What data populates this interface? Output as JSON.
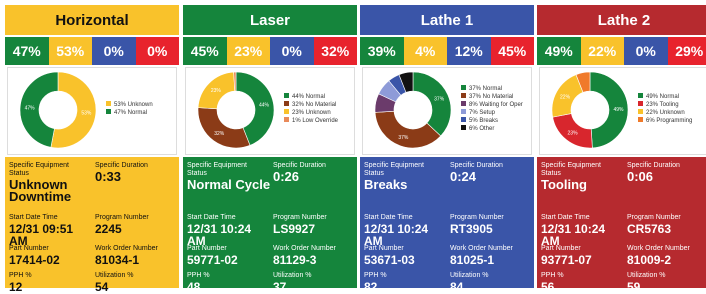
{
  "panels": [
    {
      "title": "Horizontal",
      "header_color": "#f9c22b",
      "header_text_color": "#111111",
      "info_color": "#f9c22b",
      "info_text_color": "#111111",
      "percent_cells": [
        {
          "text": "47%",
          "color": "#15853c"
        },
        {
          "text": "53%",
          "color": "#f9c22b"
        },
        {
          "text": "0%",
          "color": "#3a55a8"
        },
        {
          "text": "0%",
          "color": "#e8232d"
        }
      ],
      "donut": [
        {
          "label": "53% Unknown",
          "value": 53,
          "color": "#f9c22b",
          "slice_label": "53%"
        },
        {
          "label": "47% Normal",
          "value": 47,
          "color": "#15853c",
          "slice_label": "47%"
        }
      ],
      "status_label": "Specific Equipment Status",
      "status_value": "Unknown Downtime",
      "duration_label": "Specific Duration",
      "duration_value": "0:33",
      "start_label": "Start Date Time",
      "start_value": "12/31 09:51 AM",
      "program_label": "Program Number",
      "program_value": "2245",
      "part_label": "Part Number",
      "part_value": "17414-02",
      "workorder_label": "Work Order Number",
      "workorder_value": "81034-1",
      "pph_label": "PPH %",
      "pph_value": "12",
      "util_label": "Utilization %",
      "util_value": "54"
    },
    {
      "title": "Laser",
      "header_color": "#15853c",
      "header_text_color": "#ffffff",
      "info_color": "#15853c",
      "info_text_color": "#ffffff",
      "percent_cells": [
        {
          "text": "45%",
          "color": "#15853c"
        },
        {
          "text": "23%",
          "color": "#f9c22b"
        },
        {
          "text": "0%",
          "color": "#3a55a8"
        },
        {
          "text": "32%",
          "color": "#e8232d"
        }
      ],
      "donut": [
        {
          "label": "44% Normal",
          "value": 44,
          "color": "#15853c",
          "slice_label": "44%"
        },
        {
          "label": "32% No Material",
          "value": 32,
          "color": "#8b3b17",
          "slice_label": "32%"
        },
        {
          "label": "23% Unknown",
          "value": 23,
          "color": "#f9c22b",
          "slice_label": "23%"
        },
        {
          "label": "1% Low Override",
          "value": 1,
          "color": "#e98a5a",
          "slice_label": ""
        }
      ],
      "status_label": "Specific Equipment Status",
      "status_value": "Normal Cycle",
      "duration_label": "Specific Duration",
      "duration_value": "0:26",
      "start_label": "Start Date Time",
      "start_value": "12/31 10:24 AM",
      "program_label": "Program Number",
      "program_value": "LS9927",
      "part_label": "Part Number",
      "part_value": "59771-02",
      "workorder_label": "Work Order Number",
      "workorder_value": "81129-3",
      "pph_label": "PPH %",
      "pph_value": "48",
      "util_label": "Utilization %",
      "util_value": "37"
    },
    {
      "title": "Lathe 1",
      "header_color": "#3a55a8",
      "header_text_color": "#ffffff",
      "info_color": "#3a55a8",
      "info_text_color": "#ffffff",
      "percent_cells": [
        {
          "text": "39%",
          "color": "#15853c"
        },
        {
          "text": "4%",
          "color": "#f9c22b"
        },
        {
          "text": "12%",
          "color": "#3a55a8"
        },
        {
          "text": "45%",
          "color": "#e8232d"
        }
      ],
      "donut": [
        {
          "label": "37% Normal",
          "value": 37,
          "color": "#15853c",
          "slice_label": "37%"
        },
        {
          "label": "37% No Material",
          "value": 37,
          "color": "#8b3b17",
          "slice_label": "37%"
        },
        {
          "label": "8% Waiting for Oper",
          "value": 8,
          "color": "#6b3b6b",
          "slice_label": ""
        },
        {
          "label": "7% Setup",
          "value": 7,
          "color": "#8e9bd8",
          "slice_label": ""
        },
        {
          "label": "5% Breaks",
          "value": 5,
          "color": "#3a55a8",
          "slice_label": ""
        },
        {
          "label": "6% Other",
          "value": 6,
          "color": "#111111",
          "slice_label": ""
        }
      ],
      "status_label": "Specific Equipment Status",
      "status_value": "Breaks",
      "duration_label": "Specific Duration",
      "duration_value": "0:24",
      "start_label": "Start Date Time",
      "start_value": "12/31 10:24 AM",
      "program_label": "Program Number",
      "program_value": "RT3905",
      "part_label": "Part Number",
      "part_value": "53671-03",
      "workorder_label": "Work Order Number",
      "workorder_value": "81025-1",
      "pph_label": "PPH %",
      "pph_value": "82",
      "util_label": "Utilization %",
      "util_value": "84"
    },
    {
      "title": "Lathe 2",
      "header_color": "#b62a2f",
      "header_text_color": "#ffffff",
      "info_color": "#b62a2f",
      "info_text_color": "#ffffff",
      "percent_cells": [
        {
          "text": "49%",
          "color": "#15853c"
        },
        {
          "text": "22%",
          "color": "#f9c22b"
        },
        {
          "text": "0%",
          "color": "#3a55a8"
        },
        {
          "text": "29%",
          "color": "#e8232d"
        }
      ],
      "donut": [
        {
          "label": "49% Normal",
          "value": 49,
          "color": "#15853c",
          "slice_label": "49%"
        },
        {
          "label": "23% Tooling",
          "value": 23,
          "color": "#d8262d",
          "slice_label": "23%"
        },
        {
          "label": "22% Unknown",
          "value": 22,
          "color": "#f9c22b",
          "slice_label": "22%"
        },
        {
          "label": "6% Programming",
          "value": 6,
          "color": "#f07a2a",
          "slice_label": ""
        }
      ],
      "status_label": "Specific Equipment Status",
      "status_value": "Tooling",
      "duration_label": "Specific Duration",
      "duration_value": "0:06",
      "start_label": "Start Date Time",
      "start_value": "12/31 10:24 AM",
      "program_label": "Program Number",
      "program_value": "CR5763",
      "part_label": "Part Number",
      "part_value": "93771-07",
      "workorder_label": "Work Order Number",
      "workorder_value": "81009-2",
      "pph_label": "PPH %",
      "pph_value": "56",
      "util_label": "Utilization %",
      "util_value": "59"
    }
  ]
}
